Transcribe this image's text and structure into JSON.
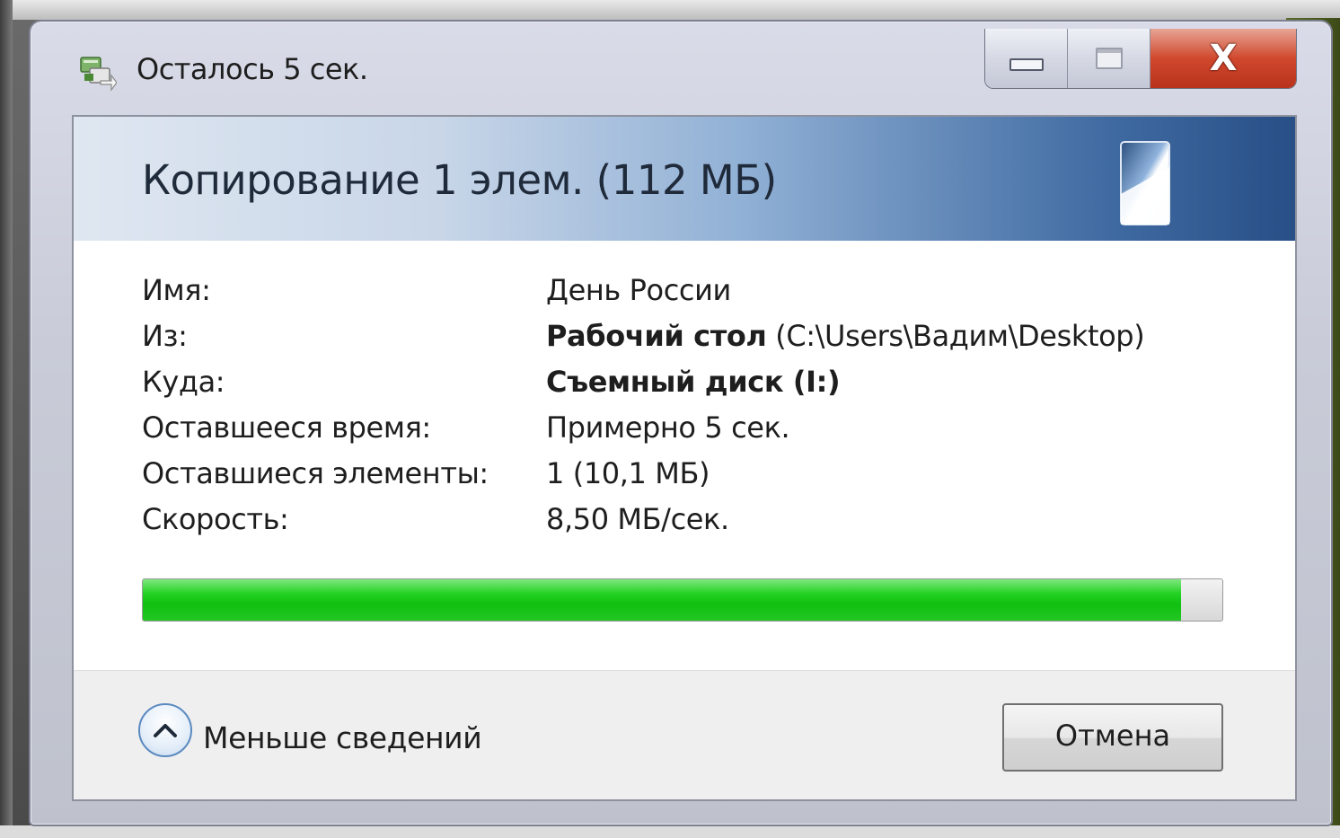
{
  "window": {
    "title": "Осталось 5 сек.",
    "minimize_icon": "minimize-icon",
    "maximize_icon": "maximize-icon",
    "close_glyph": "X"
  },
  "header": {
    "title": "Копирование 1 элем. (112 МБ)",
    "icon": "removable-drive-icon"
  },
  "details": {
    "name_label": "Имя:",
    "name_value": "День России",
    "from_label": "Из:",
    "from_value_bold": "Рабочий стол",
    "from_value_path": "(C:\\Users\\Вадим\\Desktop)",
    "to_label": "Куда:",
    "to_value_bold": "Съемный диск (I:)",
    "time_label": "Оставшееся время:",
    "time_value": "Примерно 5 сек.",
    "items_label": "Оставшиеся элементы:",
    "items_value": "1 (10,1 МБ)",
    "speed_label": "Скорость:",
    "speed_value": "8,50 МБ/сек."
  },
  "progress": {
    "percent": 96.2,
    "color": "#10c010"
  },
  "footer": {
    "less_details_label": "Меньше сведений",
    "cancel_label": "Отмена"
  },
  "colors": {
    "accent_blue": "#284f86",
    "close_red": "#d0482d",
    "progress_green": "#10c010"
  }
}
